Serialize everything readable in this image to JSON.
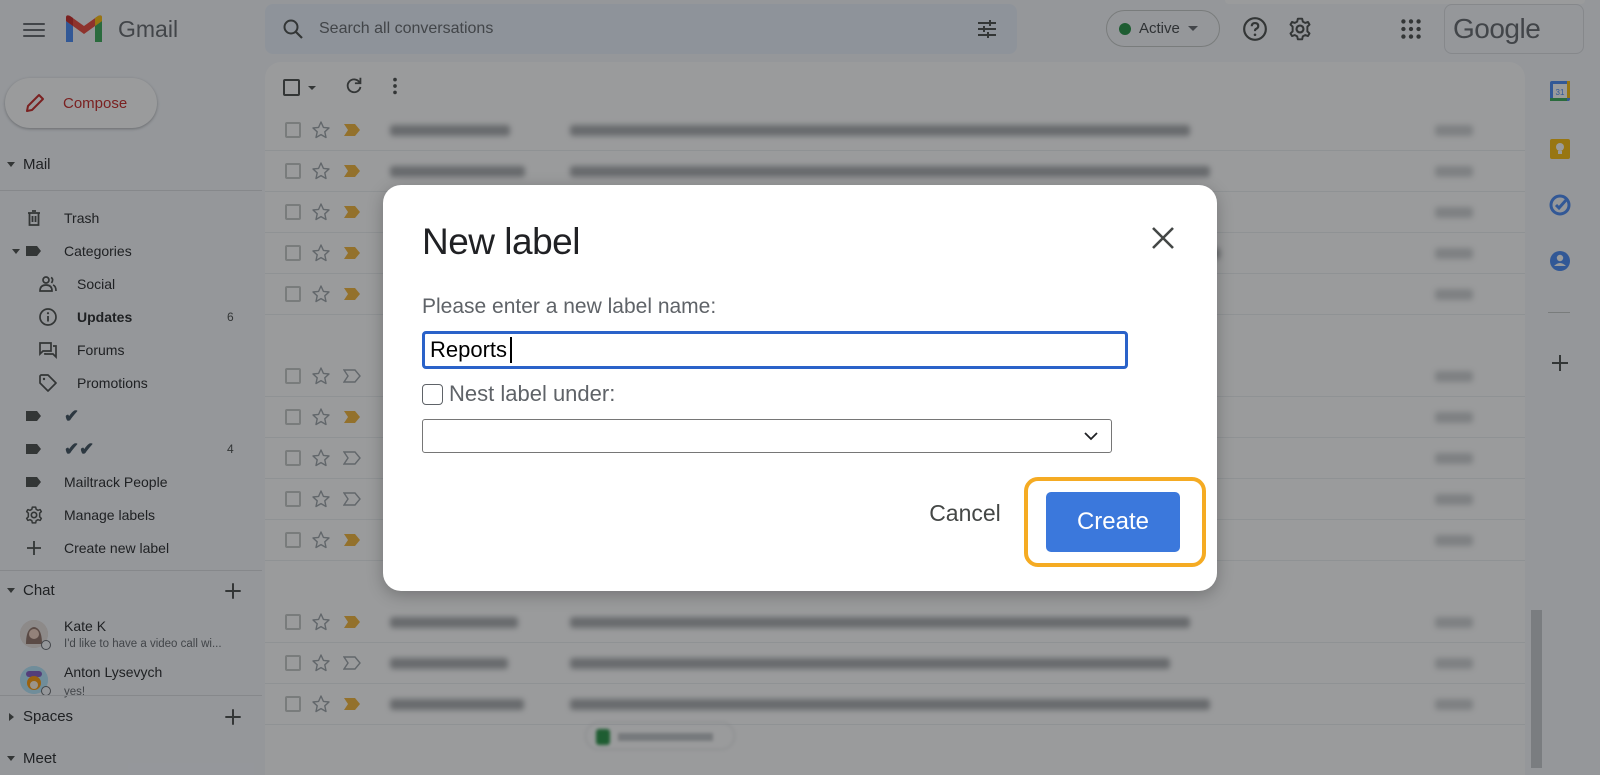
{
  "app": {
    "name": "Gmail",
    "brand_colors": {
      "red": "#ea4335",
      "blue": "#4285f4",
      "green": "#34a853",
      "yellow": "#fbbc04"
    }
  },
  "header": {
    "menu_icon": "hamburger-menu-icon",
    "search": {
      "placeholder": "Search all conversations",
      "value": ""
    },
    "search_options_icon": "tune-icon",
    "status": {
      "label": "Active",
      "color": "#1e8e3e"
    },
    "help_icon": "help-icon",
    "settings_icon": "gear-icon",
    "apps_icon": "apps-grid-icon",
    "account_label": "Google"
  },
  "sidebar": {
    "compose_label": "Compose",
    "mail_section": "Mail",
    "items": [
      {
        "label": "Trash",
        "icon": "trash-icon",
        "count": ""
      },
      {
        "label": "Categories",
        "icon": "label-icon",
        "count": ""
      },
      {
        "label": "Social",
        "icon": "people-icon",
        "count": ""
      },
      {
        "label": "Updates",
        "icon": "info-icon",
        "count": "6"
      },
      {
        "label": "Forums",
        "icon": "forum-icon",
        "count": ""
      },
      {
        "label": "Promotions",
        "icon": "tag-icon",
        "count": ""
      },
      {
        "label": "✔",
        "icon": "label-icon",
        "count": ""
      },
      {
        "label": "✔✔",
        "icon": "label-icon",
        "count": "4"
      },
      {
        "label": "Mailtrack People",
        "icon": "label-icon",
        "count": ""
      },
      {
        "label": "Manage labels",
        "icon": "gear-icon",
        "count": ""
      },
      {
        "label": "Create new label",
        "icon": "plus-icon",
        "count": ""
      }
    ],
    "chat_section": "Chat",
    "chats": [
      {
        "name": "Kate K",
        "message": "I'd like to have a video call wi..."
      },
      {
        "name": "Anton Lysevych",
        "message": "yes!"
      }
    ],
    "spaces_section": "Spaces",
    "meet_section": "Meet"
  },
  "toolbar": {
    "select_all_icon": "checkbox-icon",
    "refresh_icon": "refresh-icon",
    "more_icon": "more-vert-icon"
  },
  "email_rows": [
    {
      "important": true
    },
    {
      "important": true
    },
    {
      "important": true
    },
    {
      "important": true
    },
    {
      "important": true
    },
    {
      "important": false
    },
    {
      "important": true
    },
    {
      "important": false
    },
    {
      "important": false
    },
    {
      "important": true
    },
    {
      "important": true
    },
    {
      "important": false
    },
    {
      "important": true
    }
  ],
  "right_rail": [
    "calendar-icon",
    "keep-icon",
    "tasks-icon",
    "contacts-icon",
    "add-addon-icon"
  ],
  "dialog": {
    "title": "New label",
    "prompt": "Please enter a new label name:",
    "label_name_value": "Reports",
    "nest_checkbox_label": "Nest label under:",
    "nest_checked": false,
    "nest_parent_value": "",
    "cancel_label": "Cancel",
    "create_label": "Create",
    "create_color": "#3b78dc",
    "highlight_color": "#f5ab23"
  }
}
